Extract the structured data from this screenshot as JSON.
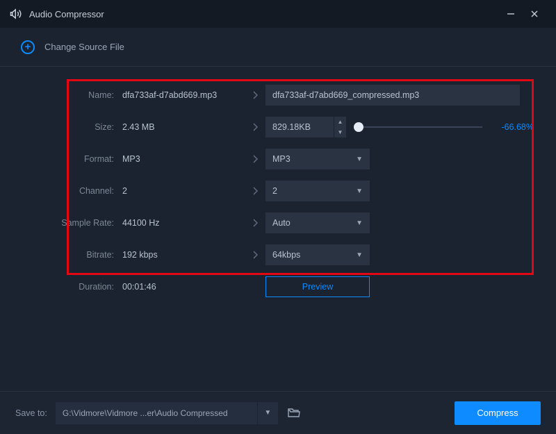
{
  "titlebar": {
    "title": "Audio Compressor"
  },
  "source": {
    "label": "Change Source File"
  },
  "fields": {
    "name": {
      "label": "Name:",
      "orig": "dfa733af-d7abd669.mp3",
      "value": "dfa733af-d7abd669_compressed.mp3"
    },
    "size": {
      "label": "Size:",
      "orig": "2.43 MB",
      "value": "829.18KB",
      "percent": "-66.68%"
    },
    "format": {
      "label": "Format:",
      "orig": "MP3",
      "value": "MP3"
    },
    "channel": {
      "label": "Channel:",
      "orig": "2",
      "value": "2"
    },
    "sample": {
      "label": "Sample Rate:",
      "orig": "44100 Hz",
      "value": "Auto"
    },
    "bitrate": {
      "label": "Bitrate:",
      "orig": "192 kbps",
      "value": "64kbps"
    },
    "duration": {
      "label": "Duration:",
      "orig": "00:01:46"
    }
  },
  "buttons": {
    "preview": "Preview",
    "compress": "Compress"
  },
  "footer": {
    "save_label": "Save to:",
    "save_path": "G:\\Vidmore\\Vidmore ...er\\Audio Compressed"
  }
}
